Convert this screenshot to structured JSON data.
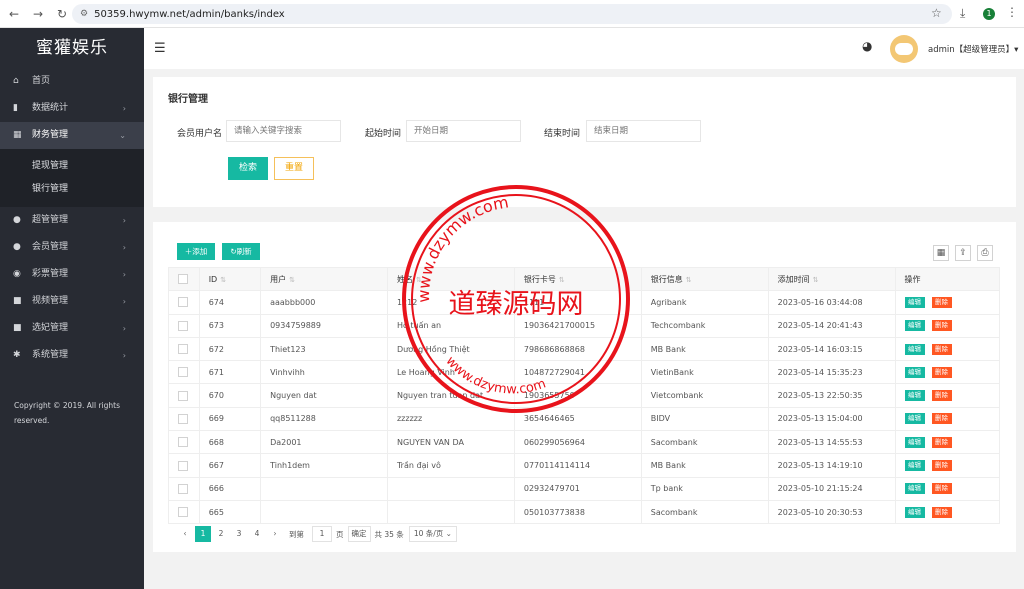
{
  "browser": {
    "url": "50359.hwymw.net/admin/banks/index",
    "extension_badge": "1"
  },
  "sidebar": {
    "logo": "蜜獾娱乐",
    "items": [
      {
        "label": "首页",
        "icon": "home-icon",
        "glyph": "⌂",
        "arrow": ""
      },
      {
        "label": "数据统计",
        "icon": "bar-chart-icon",
        "glyph": "▮",
        "arrow": "›"
      },
      {
        "label": "财务管理",
        "icon": "bank-icon",
        "glyph": "▦",
        "arrow": "⌄"
      },
      {
        "label": "超管管理",
        "icon": "user-icon",
        "glyph": "●",
        "arrow": "›"
      },
      {
        "label": "会员管理",
        "icon": "users-icon",
        "glyph": "●",
        "arrow": "›"
      },
      {
        "label": "彩票管理",
        "icon": "gamepad-icon",
        "glyph": "◉",
        "arrow": "›"
      },
      {
        "label": "视频管理",
        "icon": "video-icon",
        "glyph": "■",
        "arrow": "›"
      },
      {
        "label": "选妃管理",
        "icon": "video-icon",
        "glyph": "■",
        "arrow": "›"
      },
      {
        "label": "系统管理",
        "icon": "gear-icon",
        "glyph": "✱",
        "arrow": "›"
      }
    ],
    "sub_items": [
      "提现管理",
      "银行管理"
    ],
    "copyright": "Copyright © 2019. All rights reserved."
  },
  "topbar": {
    "user_label": "admin【超级管理员】▾"
  },
  "search": {
    "title": "银行管理",
    "member_label": "会员用户名",
    "member_placeholder": "请输入关键字搜索",
    "start_label": "起始时间",
    "start_placeholder": "开始日期",
    "end_label": "结束时间",
    "end_placeholder": "结束日期",
    "search_button": "检索",
    "reset_button": "重置"
  },
  "toolbar": {
    "add_button": "添加",
    "refresh_button": "刷新"
  },
  "table": {
    "headers": [
      "",
      "ID",
      "用户",
      "姓名",
      "银行卡号",
      "银行信息",
      "添加时间",
      "操作"
    ],
    "edit_label": "编辑",
    "delete_label": "删除",
    "rows": [
      [
        "674",
        "aaabbb000",
        "1212",
        "1111",
        "Agribank",
        "2023-05-16 03:44:08"
      ],
      [
        "673",
        "0934759889",
        "Hồ tuấn an",
        "19036421700015",
        "Techcombank",
        "2023-05-14 20:41:43"
      ],
      [
        "672",
        "Thiet123",
        "Dương Hồng Thiệt",
        "798686868868",
        "MB Bank",
        "2023-05-14 16:03:15"
      ],
      [
        "671",
        "Vinhvihh",
        "Le Hoang Vinh",
        "104872729041",
        "VietinBank",
        "2023-05-14 15:35:23"
      ],
      [
        "670",
        "Nguyen dat",
        "Nguyen tran tuan dat",
        "1903655750",
        "Vietcombank",
        "2023-05-13 22:50:35"
      ],
      [
        "669",
        "qq8511288",
        "zzzzzz",
        "3654646465",
        "BIDV",
        "2023-05-13 15:04:00"
      ],
      [
        "668",
        "Da2001",
        "NGUYEN VAN DA",
        "060299056964",
        "Sacombank",
        "2023-05-13 14:55:53"
      ],
      [
        "667",
        "Tinh1dem",
        "Trần đại vô",
        "0770114114114",
        "MB Bank",
        "2023-05-13 14:19:10"
      ],
      [
        "666",
        "",
        "",
        "02932479701",
        "Tp bank",
        "2023-05-10 21:15:24"
      ],
      [
        "665",
        "",
        "",
        "050103773838",
        "Sacombank",
        "2023-05-10 20:30:53"
      ]
    ]
  },
  "pagination": {
    "prev": "‹",
    "pages": [
      "1",
      "2",
      "3",
      "4"
    ],
    "current": "1",
    "next": "›",
    "goto_label": "到第",
    "goto_value": "1",
    "page_unit": "页",
    "confirm": "确定",
    "total": "共 35 条",
    "page_size": "10 条/页"
  },
  "watermark": {
    "center_text": "道臻源码网",
    "ring_top": "www.dzymw.com",
    "ring_bottom": "www.dzymw.com",
    "color": "#e8131b"
  }
}
